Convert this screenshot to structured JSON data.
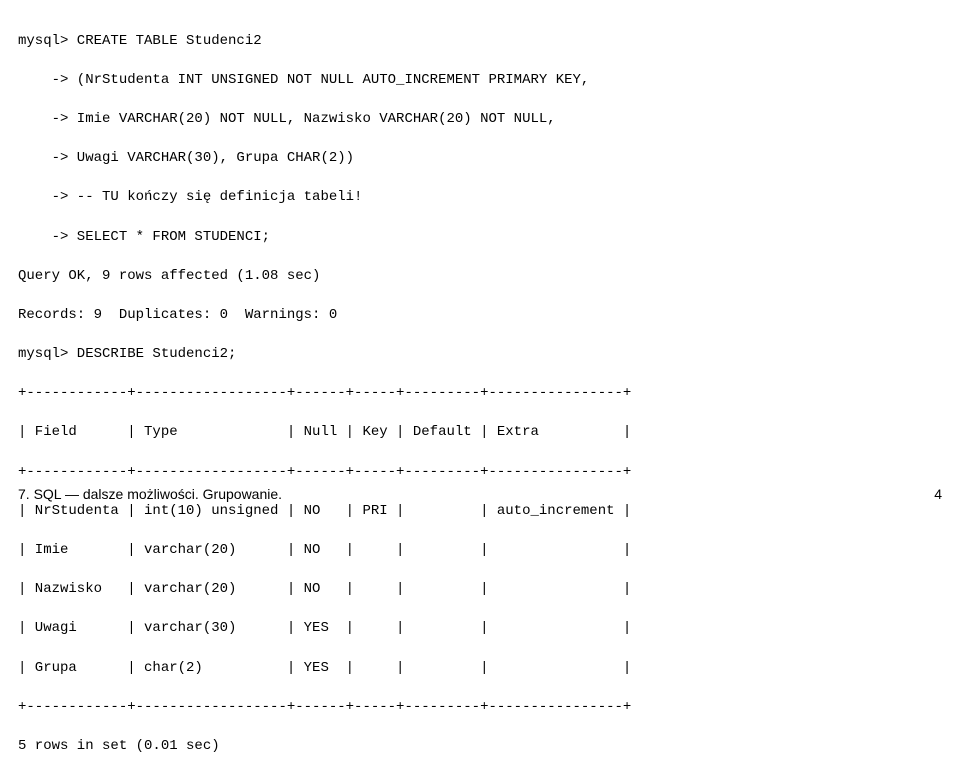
{
  "terminal": {
    "line1": "mysql> CREATE TABLE Studenci2",
    "line2": "    -> (NrStudenta INT UNSIGNED NOT NULL AUTO_INCREMENT PRIMARY KEY,",
    "line3": "    -> Imie VARCHAR(20) NOT NULL, Nazwisko VARCHAR(20) NOT NULL,",
    "line4": "    -> Uwagi VARCHAR(30), Grupa CHAR(2))",
    "line5": "    -> -- TU kończy się definicja tabeli!",
    "line6": "    -> SELECT * FROM STUDENCI;",
    "line7": "Query OK, 9 rows affected (1.08 sec)",
    "line8": "Records: 9  Duplicates: 0  Warnings: 0",
    "line9": "mysql> DESCRIBE Studenci2;",
    "sep1": "+------------+------------------+------+-----+---------+----------------+",
    "header": "| Field      | Type             | Null | Key | Default | Extra          |",
    "sep2": "+------------+------------------+------+-----+---------+----------------+",
    "row1": "| NrStudenta | int(10) unsigned | NO   | PRI |         | auto_increment |",
    "row2": "| Imie       | varchar(20)      | NO   |     |         |                |",
    "row3": "| Nazwisko   | varchar(20)      | NO   |     |         |                |",
    "row4": "| Uwagi      | varchar(30)      | YES  |     |         |                |",
    "row5": "| Grupa      | char(2)          | YES  |     |         |                |",
    "sep3": "+------------+------------------+------+-----+---------+----------------+",
    "result": "5 rows in set (0.01 sec)"
  },
  "footer": {
    "left": "7. SQL — dalsze możliwości. Grupowanie.",
    "right": "4"
  }
}
